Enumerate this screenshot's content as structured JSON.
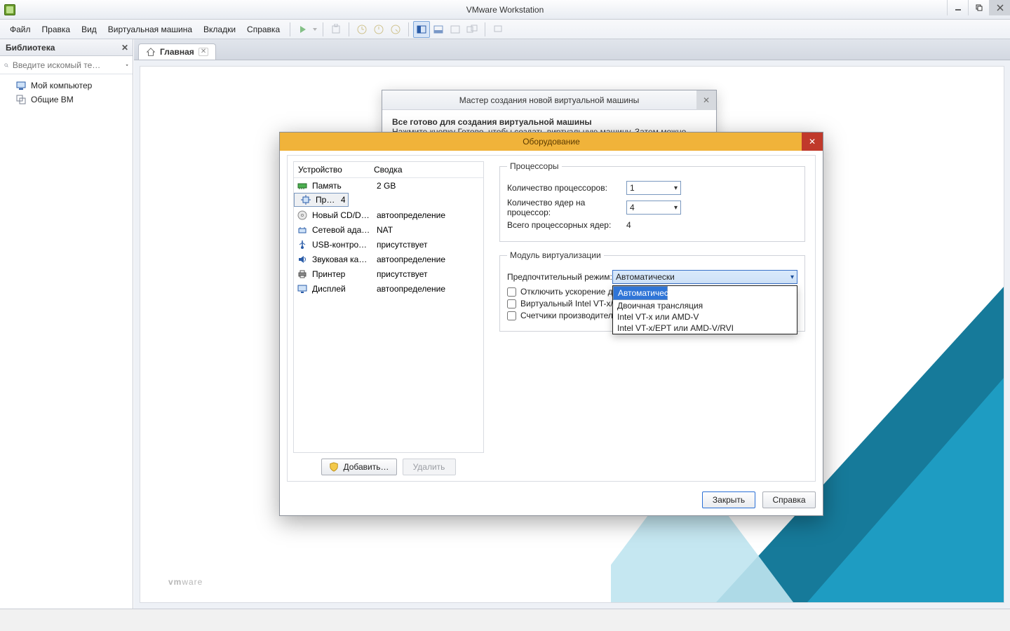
{
  "app": {
    "title": "VMware Workstation"
  },
  "menu": {
    "file": "Файл",
    "edit": "Правка",
    "view": "Вид",
    "vm": "Виртуальная машина",
    "tabs": "Вкладки",
    "help": "Справка"
  },
  "sidebar": {
    "title": "Библиотека",
    "search_placeholder": "Введите искомый те…",
    "items": [
      {
        "label": "Мой компьютер"
      },
      {
        "label": "Общие ВМ"
      }
    ]
  },
  "tab": {
    "home": "Главная"
  },
  "logo": {
    "brand": "vm",
    "suffix": "ware"
  },
  "wizard": {
    "title": "Мастер создания новой виртуальной машины",
    "heading": "Все готово для создания виртуальной машины",
    "sub": "Нажмите кнопку Готово, чтобы создать виртуальную машину. Затем можно"
  },
  "hw": {
    "title": "Оборудование",
    "col_device": "Устройство",
    "col_summary": "Сводка",
    "rows": [
      {
        "name": "Память",
        "summary": "2 GB",
        "icon": "memory"
      },
      {
        "name": "Процессор",
        "summary": "4",
        "icon": "cpu",
        "selected": true
      },
      {
        "name": "Новый CD/DV…",
        "summary": "автоопределение",
        "icon": "cd"
      },
      {
        "name": "Сетевой адап…",
        "summary": "NAT",
        "icon": "net"
      },
      {
        "name": "USB-контроллер",
        "summary": "присутствует",
        "icon": "usb"
      },
      {
        "name": "Звуковая карта",
        "summary": "автоопределение",
        "icon": "sound"
      },
      {
        "name": "Принтер",
        "summary": "присутствует",
        "icon": "printer"
      },
      {
        "name": "Дисплей",
        "summary": "автоопределение",
        "icon": "display"
      }
    ],
    "add_label": "Добавить…",
    "remove_label": "Удалить",
    "close_label": "Закрыть",
    "help_label": "Справка"
  },
  "proc": {
    "group": "Процессоры",
    "count_label": "Количество процессоров:",
    "count_value": "1",
    "cores_label": "Количество ядер на процессор:",
    "cores_value": "4",
    "total_label": "Всего процессорных ядер:",
    "total_value": "4"
  },
  "virt": {
    "group": "Модуль виртуализации",
    "mode_label": "Предпочтительный режим:",
    "mode_value": "Автоматически",
    "checks": [
      "Отключить ускорение дл",
      "Виртуальный Intel VT-x/E",
      "Счетчики производитель"
    ],
    "options": [
      "Автоматически",
      "Двоичная трансляция",
      "Intel VT-x или AMD-V",
      "Intel VT-x/EPT или AMD-V/RVI"
    ]
  }
}
